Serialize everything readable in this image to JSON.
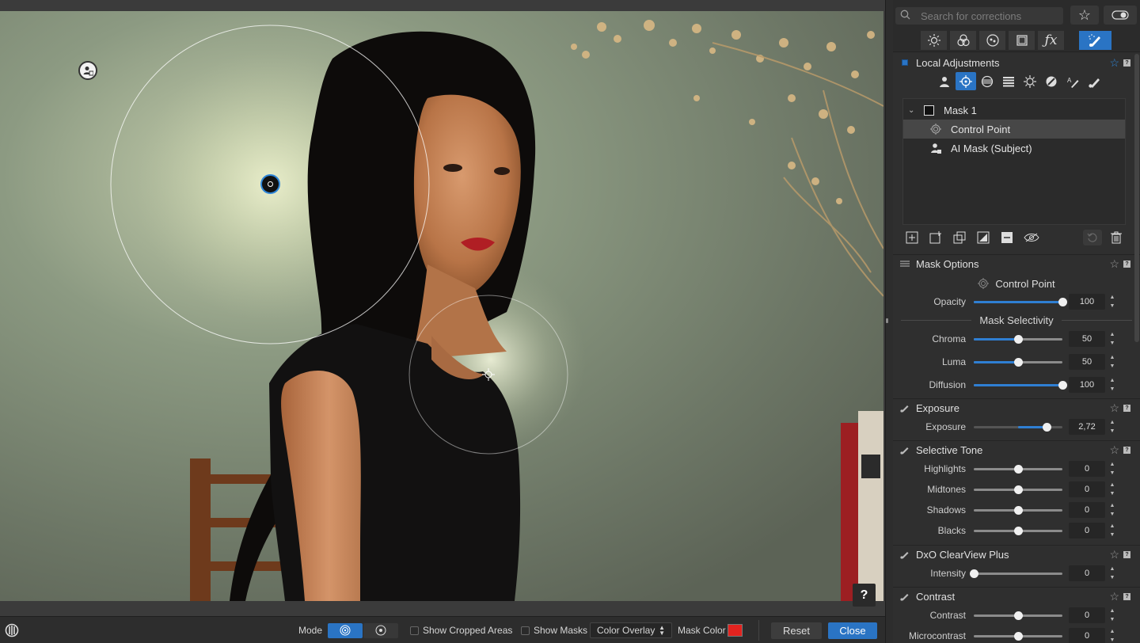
{
  "canvas": {
    "help_label": "?"
  },
  "toolbar": {
    "mode_label": "Mode",
    "show_cropped_label": "Show Cropped Areas",
    "show_masks_label": "Show Masks",
    "overlay_value": "Color Overlay",
    "mask_color_label": "Mask Color",
    "mask_color": "#e3231f",
    "reset_label": "Reset",
    "close_label": "Close"
  },
  "panel": {
    "search_placeholder": "Search for corrections",
    "tabs": [
      "light-icon",
      "color-icon",
      "detail-icon",
      "geometry-icon",
      "fx-icon",
      "local-adjustments-icon"
    ],
    "local_adjustments": {
      "title": "Local Adjustments",
      "tools": [
        "ai-mask-icon",
        "control-point-icon",
        "control-line-icon",
        "graduated-filter-icon",
        "auto-mask-icon",
        "eraser-icon",
        "brush-a-icon",
        "brush-icon"
      ],
      "masks": {
        "mask_name": "Mask 1",
        "items": [
          "Control Point",
          "AI Mask (Subject)"
        ]
      }
    },
    "mask_options": {
      "title": "Mask Options",
      "control_point_label": "Control Point",
      "opacity": {
        "label": "Opacity",
        "value": "100",
        "level": 1.0
      },
      "selectivity_label": "Mask Selectivity",
      "chroma": {
        "label": "Chroma",
        "value": "50",
        "level": 0.5
      },
      "luma": {
        "label": "Luma",
        "value": "50",
        "level": 0.5
      },
      "diffusion": {
        "label": "Diffusion",
        "value": "100",
        "level": 1.0
      }
    },
    "exposure": {
      "title": "Exposure",
      "exposure": {
        "label": "Exposure",
        "value": "2,72",
        "level": 0.82
      }
    },
    "selective_tone": {
      "title": "Selective Tone",
      "highlights": {
        "label": "Highlights",
        "value": "0",
        "level": 0.5
      },
      "midtones": {
        "label": "Midtones",
        "value": "0",
        "level": 0.5
      },
      "shadows": {
        "label": "Shadows",
        "value": "0",
        "level": 0.5
      },
      "blacks": {
        "label": "Blacks",
        "value": "0",
        "level": 0.5
      }
    },
    "clearview": {
      "title": "DxO ClearView Plus",
      "intensity": {
        "label": "Intensity",
        "value": "0",
        "level": 0.0
      }
    },
    "contrast": {
      "title": "Contrast",
      "contrast": {
        "label": "Contrast",
        "value": "0",
        "level": 0.5
      },
      "microcontrast": {
        "label": "Microcontrast",
        "value": "0",
        "level": 0.5
      }
    }
  },
  "colors": {
    "accent": "#2a74c4",
    "panel_bg": "#2f2f2f"
  }
}
